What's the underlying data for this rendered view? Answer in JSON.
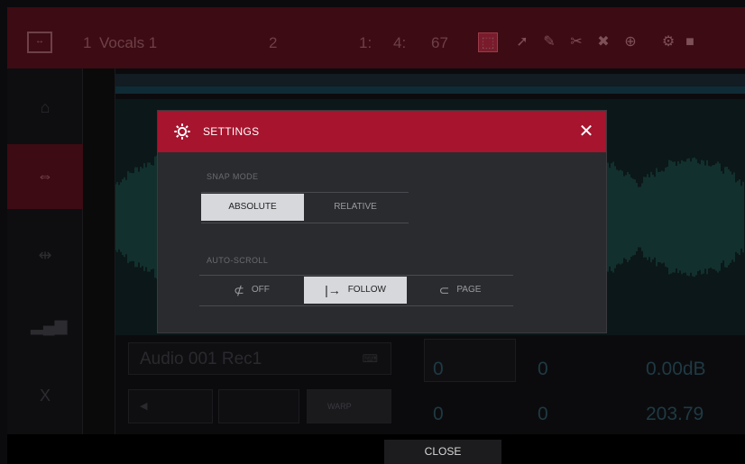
{
  "topbar": {
    "track_number": "1",
    "track_name": "Vocals 1",
    "snap_value": "2",
    "position_bars": "1:",
    "position_beats": "4:",
    "position_ticks": "67"
  },
  "lower_panel": {
    "sample_name": "Audio 001 Rec1",
    "value_a": "0",
    "value_b": "0",
    "gain_value": "0.00dB",
    "value_c": "0",
    "value_d": "0",
    "bpm_value": "203.79",
    "warp_label": "WARP"
  },
  "dialog": {
    "title": "SETTINGS",
    "snap_mode": {
      "label": "SNAP MODE",
      "options": [
        "ABSOLUTE",
        "RELATIVE"
      ],
      "selected": "ABSOLUTE"
    },
    "auto_scroll": {
      "label": "AUTO-SCROLL",
      "options": [
        "OFF",
        "FOLLOW",
        "PAGE"
      ],
      "selected": "FOLLOW"
    }
  },
  "footer": {
    "close_label": "CLOSE"
  },
  "colors": {
    "header_red": "#a6142e",
    "dialog_bg": "#2a2b2e",
    "active_segment": "#d6d8dc",
    "waveform_teal": "#1f5a55"
  },
  "icons": {
    "dialog": "gear-icon",
    "close": "close-icon",
    "auto_scroll_off": "no-scroll-icon",
    "auto_scroll_follow": "arrow-right-bar-icon",
    "auto_scroll_page": "page-wrap-icon"
  }
}
